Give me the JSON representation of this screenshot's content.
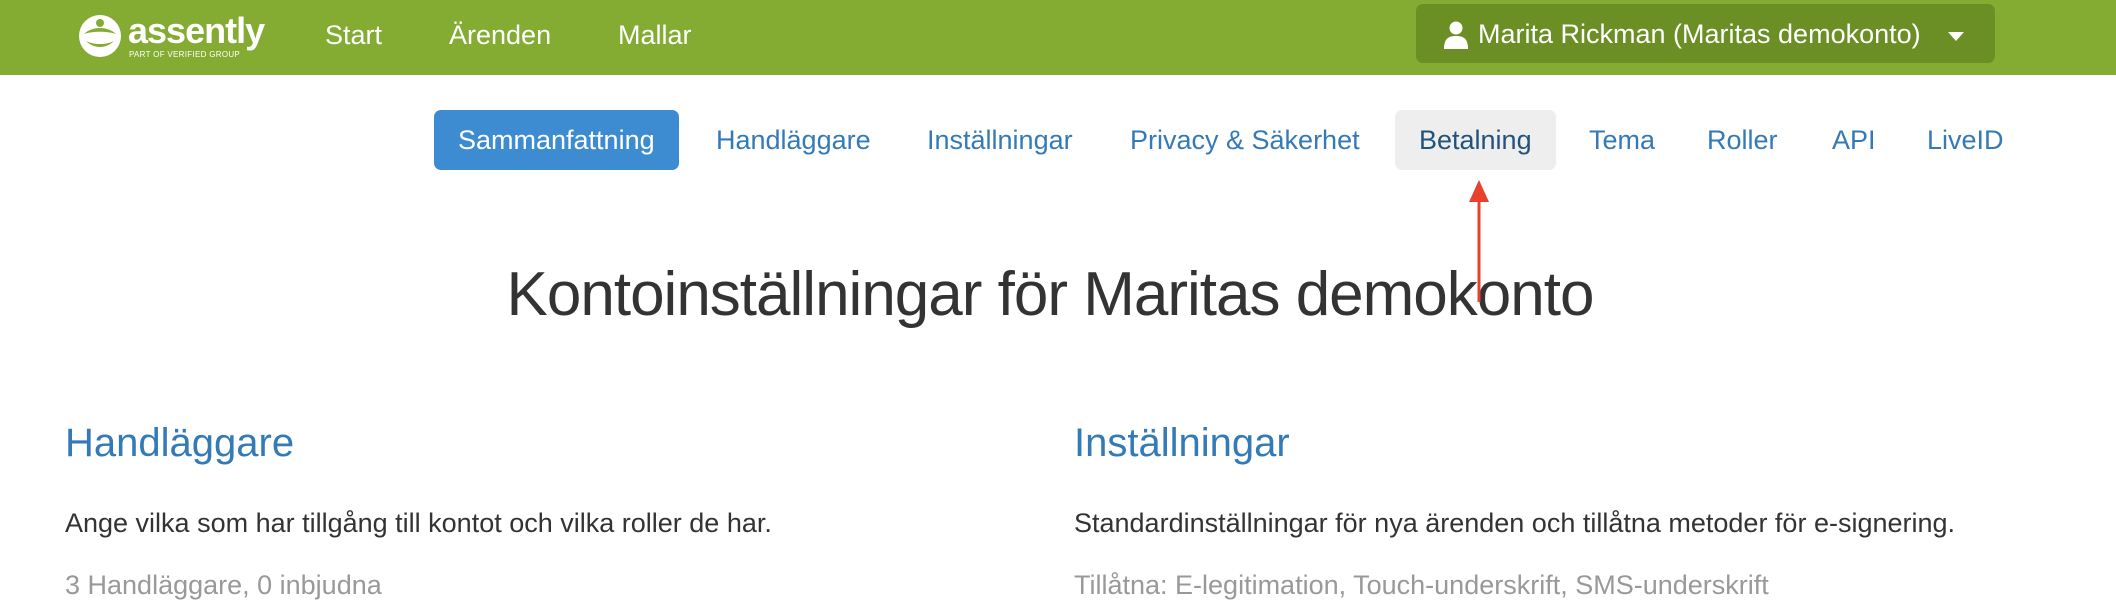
{
  "brand": {
    "name": "assently",
    "tagline": "PART OF VERIFIED GROUP"
  },
  "topnav": {
    "items": [
      {
        "label": "Start"
      },
      {
        "label": "Ärenden"
      },
      {
        "label": "Mallar"
      }
    ],
    "user_label": "Marita Rickman (Maritas demokonto)"
  },
  "tabs": [
    {
      "label": "Sammanfattning",
      "state": "active"
    },
    {
      "label": "Handläggare",
      "state": "normal"
    },
    {
      "label": "Inställningar",
      "state": "normal"
    },
    {
      "label": "Privacy & Säkerhet",
      "state": "normal"
    },
    {
      "label": "Betalning",
      "state": "hover"
    },
    {
      "label": "Tema",
      "state": "normal"
    },
    {
      "label": "Roller",
      "state": "normal"
    },
    {
      "label": "API",
      "state": "normal"
    },
    {
      "label": "LiveID",
      "state": "normal"
    }
  ],
  "page": {
    "title": "Kontoinställningar för Maritas demokonto"
  },
  "sections": [
    {
      "title": "Handläggare",
      "description": "Ange vilka som har tillgång till kontot och vilka roller de har.",
      "meta": "3 Handläggare, 0 inbjudna"
    },
    {
      "title": "Inställningar",
      "description": "Standardinställningar för nya ärenden och tillåtna metoder för e-signering.",
      "meta": "Tillåtna: E-legitimation, Touch-underskrift, SMS-underskrift"
    }
  ],
  "colors": {
    "topbar": "#84ac33",
    "user_button": "#6b8f24",
    "active_tab": "#3d8bd0",
    "link": "#337ab7",
    "annotation_arrow": "#e8412c"
  },
  "icons": {
    "logo": "assently-logo-mark",
    "user": "user-icon",
    "caret": "caret-down-icon"
  }
}
